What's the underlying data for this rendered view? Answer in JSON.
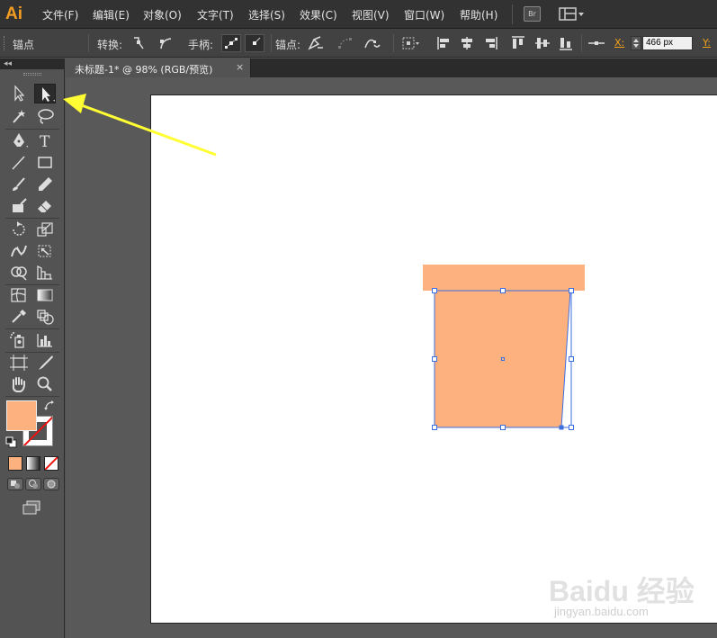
{
  "app": {
    "logo_text": "Ai"
  },
  "menu": {
    "items": [
      {
        "label": "文件(F)"
      },
      {
        "label": "编辑(E)"
      },
      {
        "label": "对象(O)"
      },
      {
        "label": "文字(T)"
      },
      {
        "label": "选择(S)"
      },
      {
        "label": "效果(C)"
      },
      {
        "label": "视图(V)"
      },
      {
        "label": "窗口(W)"
      },
      {
        "label": "帮助(H)"
      }
    ],
    "bridge_label": "Br"
  },
  "control_bar": {
    "mode_label": "锚点",
    "convert_label": "转换:",
    "handles_label": "手柄:",
    "anchors_label": "锚点:",
    "x_label": "X:",
    "x_value": "466 px",
    "y_label": "Y:"
  },
  "document": {
    "tab_title": "未标题-1* @ 98% (RGB/预览)",
    "close_glyph": "×"
  },
  "colors": {
    "fill": "#fdb17e",
    "shape_fill": "#fdb17e",
    "selection": "#3d6fe0",
    "accent": "#f49d20",
    "arrow": "#ffff33"
  },
  "tools": {
    "active": "direct-selection-tool",
    "type_glyph": "T"
  },
  "watermark": {
    "logo": "Baidu 经验",
    "url": "jingyan.baidu.com"
  }
}
